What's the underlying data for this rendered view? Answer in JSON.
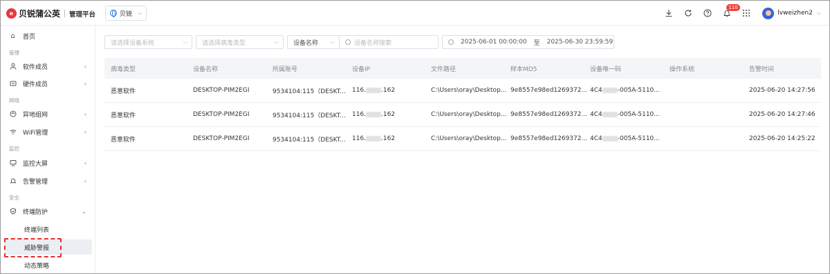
{
  "app": {
    "brand": "贝锐蒲公英",
    "subtitle": "管理平台",
    "logo_letter": "e",
    "org_selector": "贝锐",
    "notification_count": "110",
    "username": "lvweizhen2",
    "accent_color": "#2f6fe4",
    "highlight_color": "#e52d2d"
  },
  "sidebar": {
    "home": "首页",
    "group_manage": "管理",
    "software_members": "软件成员",
    "hardware_members": "硬件成员",
    "group_network": "网络",
    "remote_network": "异地组网",
    "wifi_manage": "WiFi管理",
    "group_monitor": "监控",
    "monitor_screen": "监控大屏",
    "alert_manage": "告警管理",
    "group_security": "安全",
    "endpoint_protection": "终端防护",
    "endpoint_list": "终端列表",
    "threat_alerts": "威胁警报",
    "dynamic_policy": "动态策略"
  },
  "filters": {
    "device_system_placeholder": "请选择设备系统",
    "virus_type_placeholder": "请选择病毒类型",
    "search_field": "设备名称",
    "search_placeholder": "设备名称搜索",
    "date_start": "2025-06-01 00:00:00",
    "date_to": "至",
    "date_end": "2025-06-30 23:59:59"
  },
  "table": {
    "headers": [
      "病毒类型",
      "设备名称",
      "所属账号",
      "设备IP",
      "文件路径",
      "样本MD5",
      "设备唯一码",
      "操作系统",
      "告警时间"
    ],
    "rows": [
      {
        "virus_type": "恶意软件",
        "device_name": "DESKTOP-PIM2EGI",
        "account": "9534104:115（DESKT...",
        "ip_prefix": "116.",
        "ip_suffix": ".162",
        "file_path": "C:\\Users\\oray\\Desktop...",
        "md5": "9e8557e98ed1269372...",
        "uid_prefix": "4C4",
        "uid_suffix": "-005A-5110...",
        "os": "",
        "alert_time": "2025-06-20 14:27:56"
      },
      {
        "virus_type": "恶意软件",
        "device_name": "DESKTOP-PIM2EGI",
        "account": "9534104:115（DESKT...",
        "ip_prefix": "116.",
        "ip_suffix": ".162",
        "file_path": "C:\\Users\\oray\\Desktop...",
        "md5": "9e8557e98ed1269372...",
        "uid_prefix": "4C4",
        "uid_suffix": "-005A-5110...",
        "os": "",
        "alert_time": "2025-06-20 14:27:46"
      },
      {
        "virus_type": "恶意软件",
        "device_name": "DESKTOP-PIM2EGI",
        "account": "9534104:115（DESKT...",
        "ip_prefix": "116.",
        "ip_suffix": ".162",
        "file_path": "C:\\Users\\oray\\Desktop...",
        "md5": "9e8557e98ed1269372...",
        "uid_prefix": "4C4",
        "uid_suffix": "-005A-5110...",
        "os": "",
        "alert_time": "2025-06-20 14:25:22"
      }
    ]
  }
}
